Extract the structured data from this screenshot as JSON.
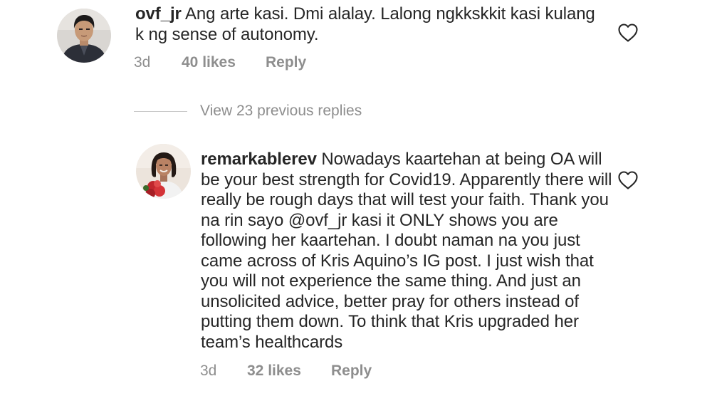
{
  "comment_1": {
    "username": "ovf_jr",
    "text": "Ang arte kasi. Dmi alalay. Lalong ngkkskkit kasi kulang k ng sense of autonomy.",
    "time": "3d",
    "likes": "40 likes",
    "reply": "Reply"
  },
  "view_replies": {
    "label": "View 23 previous replies"
  },
  "comment_2": {
    "username": "remarkablerev",
    "text_before_mention": "Nowadays kaartehan at being OA will be your best strength for Covid19. Apparently there will really be rough days that will test your faith. Thank you na rin sayo ",
    "mention": "@ovf_jr",
    "text_after_mention": " kasi it ONLY shows you are following her kaartehan. I doubt naman na you just came across of Kris Aquino’s IG post. I just wish that you will not experience the same thing. And just an unsolicited advice, better pray for others instead of putting them down. To think that Kris upgraded her team’s healthcards",
    "time": "3d",
    "likes": "32 likes",
    "reply": "Reply"
  },
  "icons": {
    "like": "heart-outline-icon"
  },
  "colors": {
    "text": "#262626",
    "secondary": "#8e8e8e",
    "divider": "#c7c7c7"
  }
}
